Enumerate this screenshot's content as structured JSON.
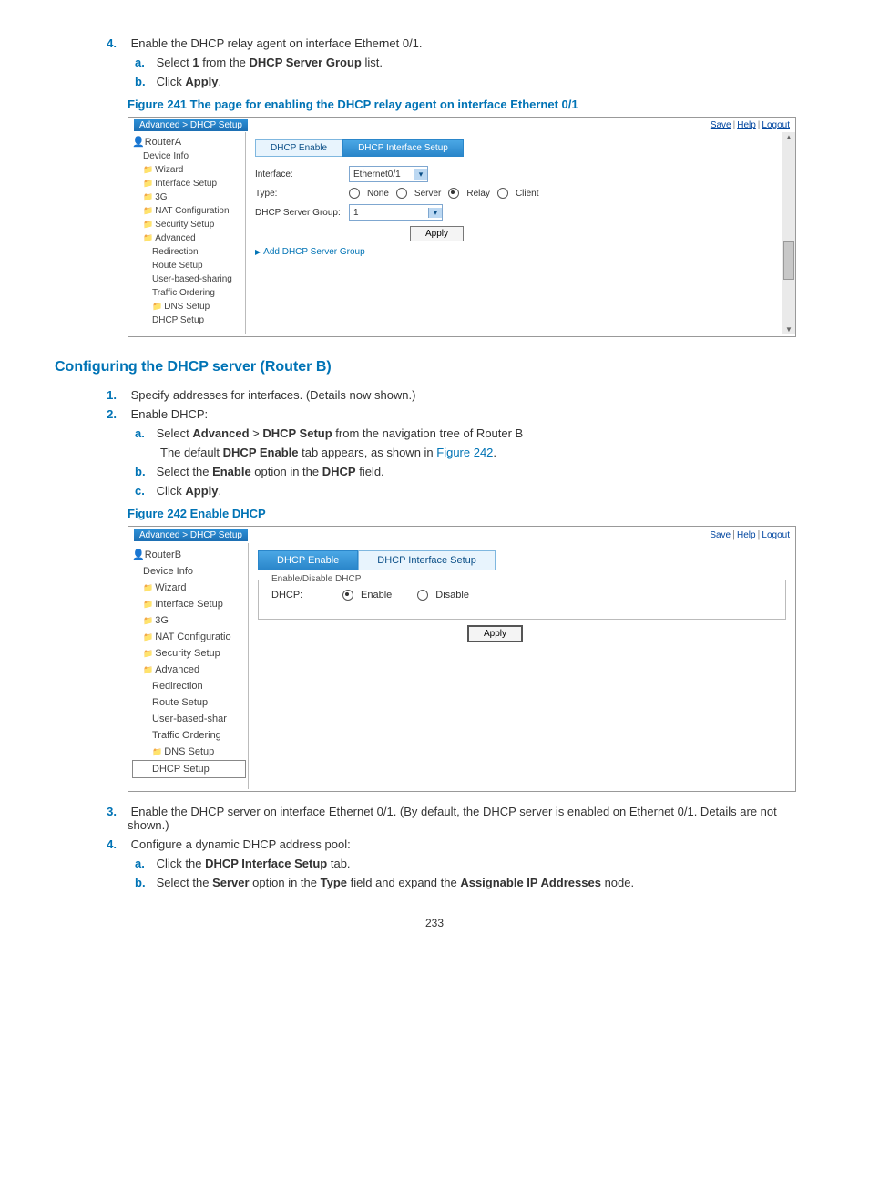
{
  "steps_main_a": {
    "num4": "4.",
    "text4": "Enable the DHCP relay agent on interface Ethernet 0/1.",
    "sub": {
      "a": {
        "let": "a.",
        "pre": "Select ",
        "bold": "1",
        "mid": " from the ",
        "bold2": "DHCP Server Group",
        "post": " list."
      },
      "b": {
        "let": "b.",
        "pre": "Click ",
        "bold": "Apply",
        "post": "."
      }
    }
  },
  "figure241": {
    "title": "Figure 241 The page for enabling the DHCP relay agent on interface Ethernet 0/1",
    "breadcrumb": "Advanced > DHCP Setup",
    "toplinks": {
      "save": "Save",
      "help": "Help",
      "logout": "Logout"
    },
    "tree_root": "RouterA",
    "tree": [
      "Device Info",
      "Wizard",
      "Interface Setup",
      "3G",
      "NAT Configuration",
      "Security Setup",
      "Advanced",
      "Redirection",
      "Route Setup",
      "User-based-sharing",
      "Traffic Ordering",
      "DNS Setup",
      "DHCP Setup"
    ],
    "tabs": {
      "enable": "DHCP Enable",
      "ifsetup": "DHCP Interface Setup"
    },
    "labels": {
      "interface": "Interface:",
      "type": "Type:",
      "group": "DHCP Server Group:"
    },
    "interface_value": "Ethernet0/1",
    "type_options": {
      "none": "None",
      "server": "Server",
      "relay": "Relay",
      "client": "Client"
    },
    "group_value": "1",
    "apply_btn": "Apply",
    "expand": "Add DHCP Server Group"
  },
  "section_title": "Configuring the DHCP server (Router B)",
  "steps_main_b": {
    "s1": {
      "num": "1.",
      "text": "Specify addresses for interfaces. (Details now shown.)"
    },
    "s2": {
      "num": "2.",
      "text": "Enable DHCP:",
      "a": {
        "let": "a.",
        "pre": "Select ",
        "b1": "Advanced",
        "mid1": " > ",
        "b2": "DHCP Setup",
        "post": " from the navigation tree of Router B"
      },
      "a_line2": {
        "pre": "The default ",
        "b1": "DHCP Enable",
        "mid": " tab appears, as shown in ",
        "link": "Figure 242",
        "post": "."
      },
      "b": {
        "let": "b.",
        "pre": "Select the ",
        "b1": "Enable",
        "mid": " option in the ",
        "b2": "DHCP",
        "post": " field."
      },
      "c": {
        "let": "c.",
        "pre": "Click ",
        "b1": "Apply",
        "post": "."
      }
    }
  },
  "figure242": {
    "title": "Figure 242 Enable DHCP",
    "breadcrumb": "Advanced > DHCP Setup",
    "toplinks": {
      "save": "Save",
      "help": "Help",
      "logout": "Logout"
    },
    "tree_root": "RouterB",
    "tree": [
      "Device Info",
      "Wizard",
      "Interface Setup",
      "3G",
      "NAT Configuratio",
      "Security Setup",
      "Advanced",
      "Redirection",
      "Route Setup",
      "User-based-shar",
      "Traffic Ordering",
      "DNS Setup",
      "DHCP Setup"
    ],
    "tabs": {
      "enable": "DHCP Enable",
      "ifsetup": "DHCP Interface Setup"
    },
    "legend": "Enable/Disable DHCP",
    "dhcp_label": "DHCP:",
    "opt_enable": "Enable",
    "opt_disable": "Disable",
    "apply_btn": "Apply"
  },
  "steps_main_c": {
    "s3": {
      "num": "3.",
      "text": "Enable the DHCP server on interface Ethernet 0/1. (By default, the DHCP server is enabled on Ethernet 0/1. Details are not shown.)"
    },
    "s4": {
      "num": "4.",
      "text": "Configure a dynamic DHCP address pool:",
      "a": {
        "let": "a.",
        "pre": "Click the ",
        "b1": "DHCP Interface Setup",
        "post": " tab."
      },
      "b": {
        "let": "b.",
        "pre": "Select the ",
        "b1": "Server",
        "mid": " option in the ",
        "b2": "Type",
        "mid2": " field and expand the ",
        "b3": "Assignable IP Addresses",
        "post": " node."
      }
    }
  },
  "page_number": "233"
}
